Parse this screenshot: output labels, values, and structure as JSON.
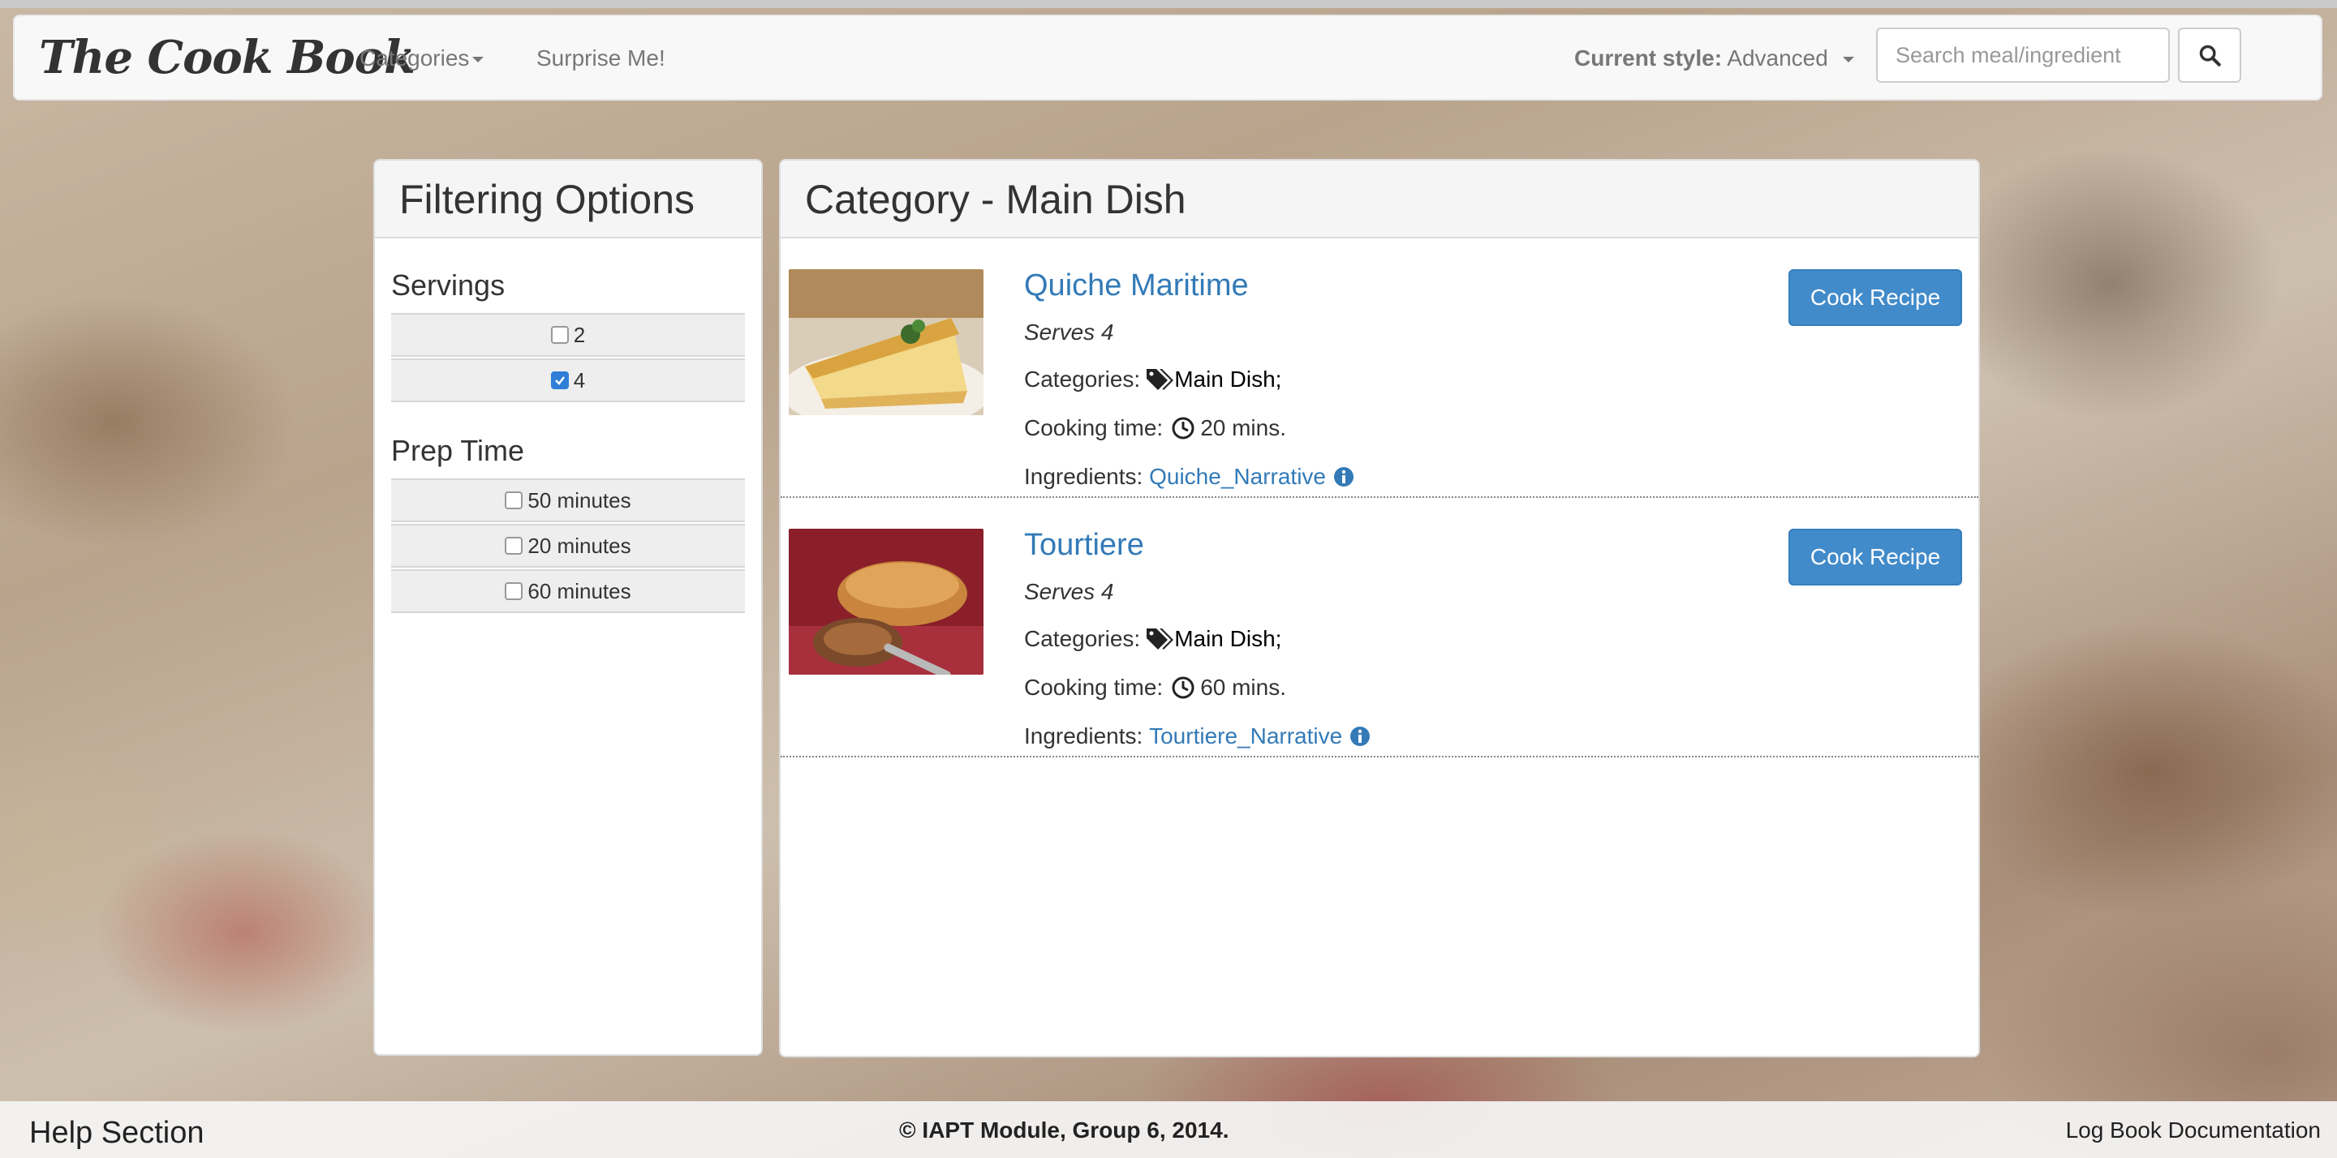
{
  "navbar": {
    "brand": "The Cook Book",
    "categories_label": "Categories",
    "surprise_label": "Surprise Me!",
    "style_prefix": "Current style:",
    "style_value": "Advanced",
    "search_placeholder": "Search meal/ingredient",
    "search_value": ""
  },
  "filters": {
    "title": "Filtering Options",
    "servings": {
      "title": "Servings",
      "options": [
        {
          "label": "2",
          "checked": false
        },
        {
          "label": "4",
          "checked": true
        }
      ]
    },
    "prep_time": {
      "title": "Prep Time",
      "options": [
        {
          "label": "50 minutes",
          "checked": false
        },
        {
          "label": "20 minutes",
          "checked": false
        },
        {
          "label": "60 minutes",
          "checked": false
        }
      ]
    }
  },
  "main": {
    "title": "Category - Main Dish",
    "recipes": [
      {
        "name": "Quiche Maritime",
        "serves": "Serves 4",
        "categories_label": "Categories:",
        "categories_value": "Main Dish;",
        "time_label": "Cooking time:",
        "time_value": "20 mins.",
        "ingredients_label": "Ingredients:",
        "ingredients_link": "Quiche_Narrative",
        "button": "Cook Recipe"
      },
      {
        "name": "Tourtiere",
        "serves": "Serves 4",
        "categories_label": "Categories:",
        "categories_value": "Main Dish;",
        "time_label": "Cooking time:",
        "time_value": "60 mins.",
        "ingredients_label": "Ingredients:",
        "ingredients_link": "Tourtiere_Narrative",
        "button": "Cook Recipe"
      }
    ]
  },
  "footer": {
    "help": "Help Section",
    "copyright": "© IAPT Module, Group 6, 2014.",
    "logbook": "Log Book Documentation"
  },
  "colors": {
    "link": "#337ab7",
    "primary_button": "#428bca",
    "checkbox_checked": "#2f7fd8"
  }
}
